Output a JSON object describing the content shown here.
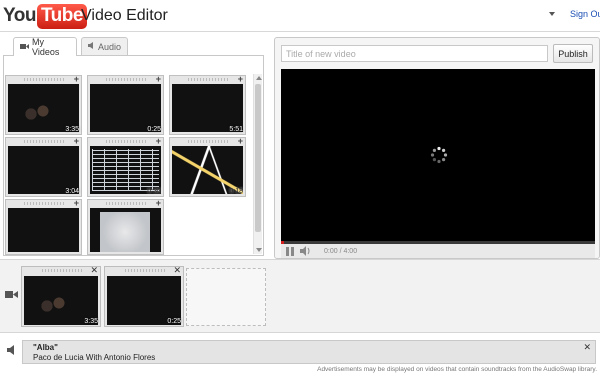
{
  "header": {
    "logo_you": "You",
    "logo_tube": "Tube",
    "title": "Video Editor",
    "sign_out": "Sign Out"
  },
  "tabs": [
    {
      "label": "My Videos",
      "icon": "camera-icon",
      "active": true
    },
    {
      "label": "Audio",
      "icon": "speaker-icon",
      "active": false
    }
  ],
  "library": {
    "clips": [
      {
        "duration": "3:35",
        "scene": "crowd"
      },
      {
        "duration": "0:25",
        "scene": "hand"
      },
      {
        "duration": "5:51",
        "scene": "fireworks"
      },
      {
        "duration": "3:04",
        "scene": "stage"
      },
      {
        "duration": "0:30",
        "scene": "spreadsheet"
      },
      {
        "duration": "0:18",
        "scene": "map"
      },
      {
        "duration": "",
        "scene": "dark"
      },
      {
        "duration": "",
        "scene": "grey"
      }
    ]
  },
  "player": {
    "title_placeholder": "Title of new video",
    "publish_label": "Publish",
    "time": "0:00 / 4:00",
    "progress": 0.01
  },
  "timeline": {
    "clips": [
      {
        "duration": "3:35",
        "scene": "crowd"
      },
      {
        "duration": "0:25",
        "scene": "hand"
      }
    ]
  },
  "audio": {
    "title": "\"Alba\"",
    "artist": "Paco de Lucia With Antonio Flores",
    "disclaimer": "Advertisements may be displayed on videos that contain soundtracks from the AudioSwap library."
  },
  "colors": {
    "accent_red": "#cc1e12",
    "link_blue": "#1a4eb4"
  }
}
